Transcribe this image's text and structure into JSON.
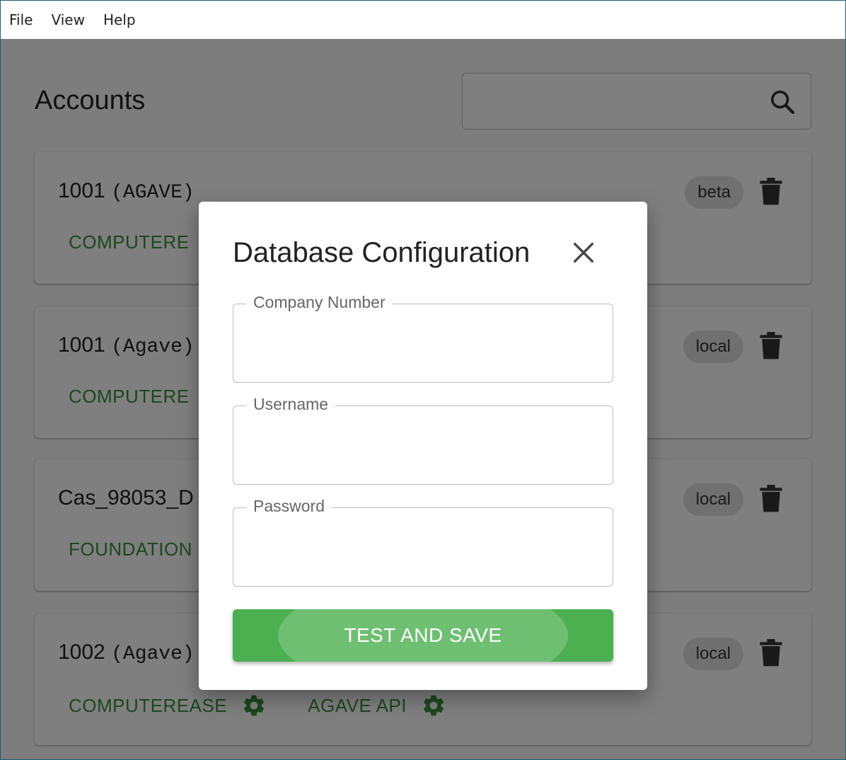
{
  "menubar": {
    "items": [
      "File",
      "View",
      "Help"
    ]
  },
  "page": {
    "title": "Accounts",
    "search": {
      "placeholder": "",
      "value": ""
    }
  },
  "accounts": [
    {
      "id": "1001",
      "name_mono": "(AGAVE)",
      "badge": "beta",
      "actions": [
        "COMPUTERE"
      ]
    },
    {
      "id": "1001",
      "name_mono": "(Agave)",
      "badge": "local",
      "actions": [
        "COMPUTERE"
      ]
    },
    {
      "id": "Cas_98053_D",
      "name_mono": "",
      "badge": "local",
      "actions": [
        "FOUNDATION"
      ]
    },
    {
      "id": "1002",
      "name_mono": "(Agave)",
      "badge": "local",
      "actions": [
        "COMPUTEREASE",
        "AGAVE API"
      ]
    }
  ],
  "dialog": {
    "title": "Database Configuration",
    "fields": [
      {
        "label": "Company Number",
        "value": ""
      },
      {
        "label": "Username",
        "value": ""
      },
      {
        "label": "Password",
        "value": ""
      }
    ],
    "submit_label": "TEST AND SAVE"
  },
  "colors": {
    "accent_green": "#4caf50",
    "action_green": "#388e3c",
    "chip_bg": "#e0e0e0"
  }
}
